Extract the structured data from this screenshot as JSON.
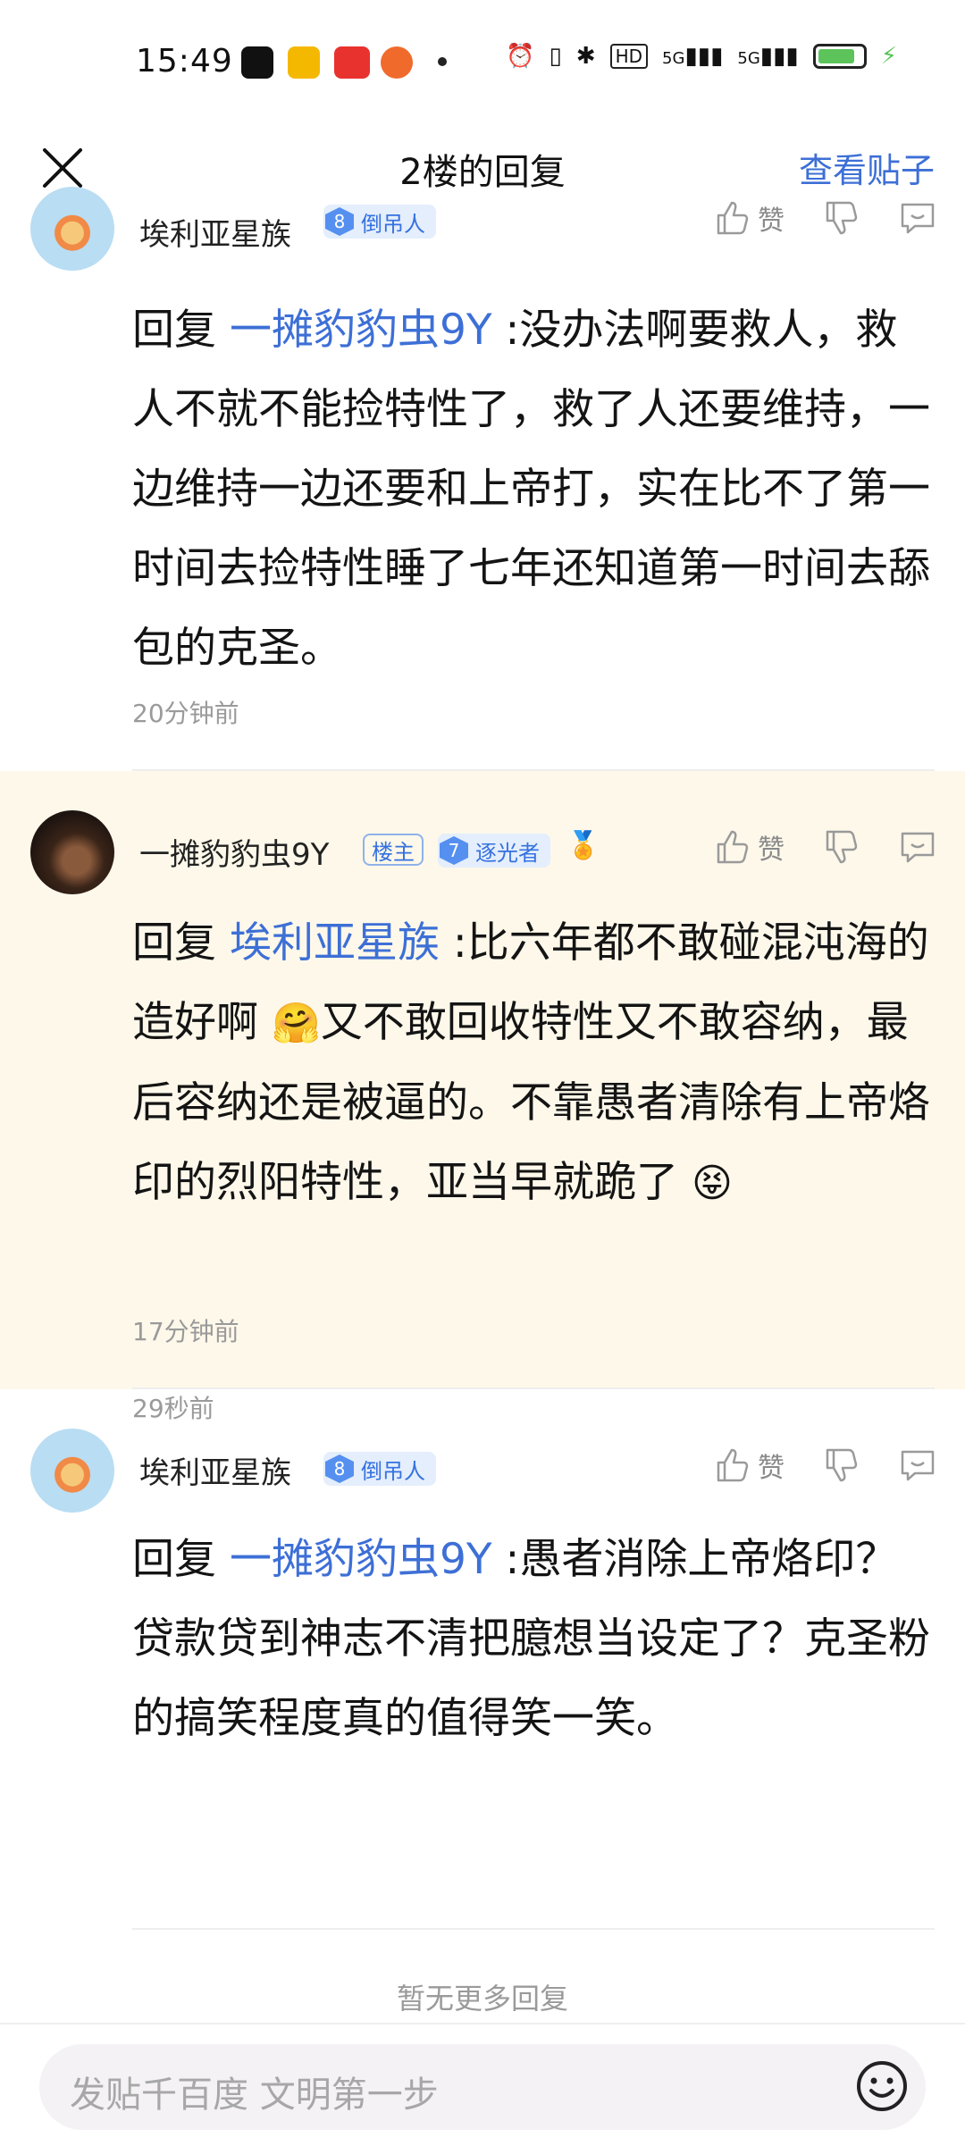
{
  "status_bar": {
    "time": "15:49",
    "network": "5G",
    "colors": {
      "tiktok": "#111111",
      "mail": "#f5b800",
      "toutiao": "#e8322e",
      "app": "#f06a2c"
    }
  },
  "nav": {
    "title": "2楼的回复",
    "view_post": "查看贴子"
  },
  "replies": [
    {
      "username": "埃利亚星族",
      "level": "8",
      "level_title": "倒吊人",
      "like_label": "赞",
      "prefix": "回复",
      "mention": "一摊豹豹虫9Y",
      "text": " :没办法啊要救人，救人不就不能捡特性了，救了人还要维持，一边维持一边还要和上帝打，实在比不了第一时间去捡特性睡了七年还知道第一时间去舔包的克圣。",
      "time": "20分钟前"
    },
    {
      "username": "一摊豹豹虫9Y",
      "op_badge": "楼主",
      "level": "7",
      "level_title": "逐光者",
      "like_label": "赞",
      "prefix": "回复",
      "mention": "埃利亚星族",
      "text_a": " :比六年都不敢碰混沌海的造好啊 ",
      "text_b": "又不敢回收特性又不敢容纳，最后容纳还是被逼的。不靠愚者清除有上帝烙印的烈阳特性，亚当早就跪了 ",
      "emoji1": "🤗",
      "emoji2": "😝",
      "time": "17分钟前"
    },
    {
      "username": "埃利亚星族",
      "level": "8",
      "level_title": "倒吊人",
      "like_label": "赞",
      "prefix": "回复",
      "mention": "一摊豹豹虫9Y",
      "text": " :愚者消除上帝烙印？贷款贷到神志不清把臆想当设定了？克圣粉的搞笑程度真的值得笑一笑。",
      "time": "29秒前"
    }
  ],
  "footer": {
    "no_more": "暂无更多回复",
    "input_placeholder": "发贴千百度 文明第一步"
  }
}
